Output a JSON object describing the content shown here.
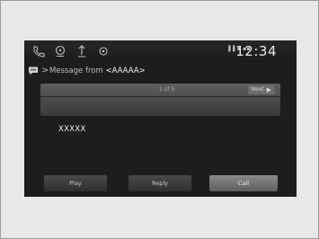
{
  "status_bar": {
    "icons": [
      "phone-icon",
      "media-icon",
      "navigation-icon",
      "settings-icon"
    ],
    "signal_text": "▐▐ ▪ ▪▪",
    "clock": "12:34"
  },
  "header": {
    "icon": "message-icon",
    "separator": ">",
    "title_prefix": "Message from ",
    "title_sender": "<AAAAA>"
  },
  "message_panel": {
    "page_counter": "1 of 5",
    "next_label": "Next",
    "next_icon": "chevron-right-icon"
  },
  "message_body": "XXXXX",
  "buttons": {
    "play": "Play",
    "reply": "Reply",
    "call": "Call"
  },
  "colors": {
    "screen_bg": "#1d1d1d",
    "panel_bg": "#4a4a4a",
    "call_button_bg": "#7a7a7a"
  }
}
